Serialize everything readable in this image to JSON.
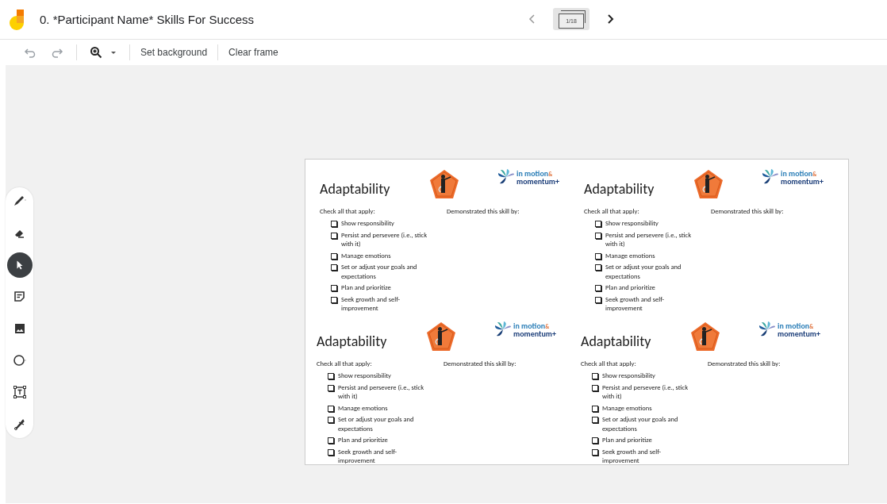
{
  "header": {
    "title": "0. *Participant Name* Skills For Success",
    "frame_counter": "1/18"
  },
  "toolbar": {
    "undo": {
      "disabled": true
    },
    "redo": {
      "disabled": true
    },
    "buttons": [
      "Set background",
      "Clear frame"
    ]
  },
  "tools": [
    {
      "kind": "pen",
      "selected": false
    },
    {
      "kind": "eraser",
      "selected": false
    },
    {
      "kind": "select",
      "selected": true
    },
    {
      "kind": "sticky",
      "selected": false
    },
    {
      "kind": "image",
      "selected": false
    },
    {
      "kind": "circle",
      "selected": false
    },
    {
      "kind": "textbox",
      "selected": false
    },
    {
      "kind": "laser",
      "selected": false
    }
  ],
  "slide": {
    "cards": [
      {
        "title": "Adaptability",
        "logo_top": "in motion",
        "logo_amp": "&",
        "logo_bottom": "momentum+",
        "check_label": "Check all that apply:",
        "demo_label": "Demonstrated this skill by:",
        "items": [
          {
            "label": "Show responsibility",
            "checked": false
          },
          {
            "label": "Persist and persevere (i.e., stick with it)",
            "checked": false
          },
          {
            "label": "Manage emotions",
            "checked": false
          },
          {
            "label": "Set or adjust your goals and expectations",
            "checked": false
          },
          {
            "label": "Plan and prioritize",
            "checked": false
          },
          {
            "label": "Seek growth and self-improvement",
            "checked": false
          }
        ]
      },
      {
        "title": "Adaptability",
        "logo_top": "in motion",
        "logo_amp": "&",
        "logo_bottom": "momentum+",
        "check_label": "Check all that apply:",
        "demo_label": "Demonstrated this skill by:",
        "items": [
          {
            "label": "Show responsibility",
            "checked": false
          },
          {
            "label": "Persist and persevere (i.e., stick with it)",
            "checked": false
          },
          {
            "label": "Manage emotions",
            "checked": false
          },
          {
            "label": "Set or adjust your goals and expectations",
            "checked": false
          },
          {
            "label": "Plan and prioritize",
            "checked": false
          },
          {
            "label": "Seek growth and self-improvement",
            "checked": false
          }
        ]
      },
      {
        "title": "Adaptability",
        "logo_top": "in motion",
        "logo_amp": "&",
        "logo_bottom": "momentum+",
        "check_label": "Check all that apply:",
        "demo_label": "Demonstrated this skill by:",
        "items": [
          {
            "label": "Show responsibility",
            "checked": false
          },
          {
            "label": "Persist and persevere (i.e., stick with it)",
            "checked": false
          },
          {
            "label": "Manage emotions",
            "checked": false
          },
          {
            "label": "Set or adjust your goals and expectations",
            "checked": false
          },
          {
            "label": "Plan and prioritize",
            "checked": false
          },
          {
            "label": "Seek growth and self-improvement",
            "checked": false
          }
        ]
      },
      {
        "title": "Adaptability",
        "logo_top": "in motion",
        "logo_amp": "&",
        "logo_bottom": "momentum+",
        "check_label": "Check all that apply:",
        "demo_label": "Demonstrated this skill by:",
        "items": [
          {
            "label": "Show responsibility",
            "checked": false
          },
          {
            "label": "Persist and persevere (i.e., stick with it)",
            "checked": false
          },
          {
            "label": "Manage emotions",
            "checked": false
          },
          {
            "label": "Set or adjust your goals and expectations",
            "checked": false
          },
          {
            "label": "Plan and prioritize",
            "checked": false
          },
          {
            "label": "Seek growth and self-improvement",
            "checked": false
          }
        ]
      }
    ]
  }
}
